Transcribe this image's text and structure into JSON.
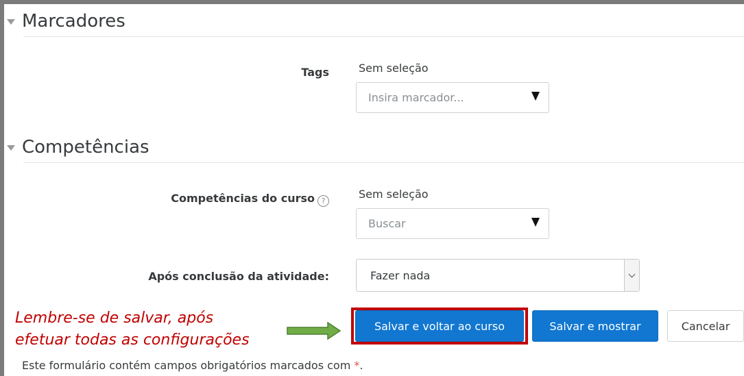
{
  "sections": {
    "tags_section": {
      "title": "Marcadores"
    },
    "competencies_section": {
      "title": "Competências"
    }
  },
  "tags": {
    "label": "Tags",
    "no_selection": "Sem seleção",
    "placeholder": "Insira marcador..."
  },
  "competencies": {
    "label": "Competências do curso",
    "help_icon": "question-circle-icon",
    "no_selection": "Sem seleção",
    "placeholder": "Buscar"
  },
  "after_completion": {
    "label": "Após conclusão da atividade:",
    "value": "Fazer nada"
  },
  "annotation": {
    "line1": "Lembre-se de salvar, após",
    "line2": "efetuar todas as configurações",
    "color": "#c00000",
    "arrow_color": "#70ad47"
  },
  "buttons": {
    "save_return": "Salvar e voltar ao curso",
    "save_display": "Salvar e mostrar",
    "cancel": "Cancelar",
    "primary_color": "#1177d1"
  },
  "footer": {
    "required_text": "Este formulário contém campos obrigatórios marcados com",
    "required_marker": "*",
    "period": "."
  }
}
